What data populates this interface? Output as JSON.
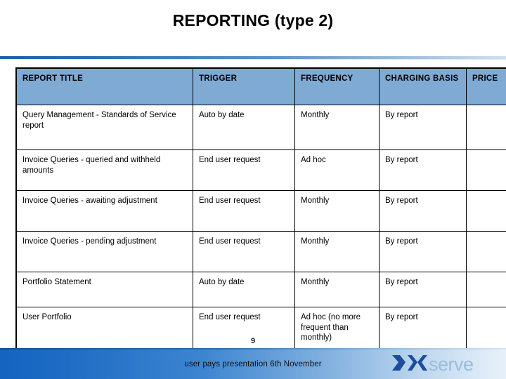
{
  "slide": {
    "title": "REPORTING (type 2)",
    "page_number": "9",
    "footer_text": "user pays presentation 6th November",
    "accent_color": "#1f5fa8",
    "header_fill": "#7FAAD4",
    "footer_gradient_start": "#1464c0",
    "footer_gradient_end": "#e8f1fa"
  },
  "logo": {
    "name": "xoserve-logo",
    "text_x": "x",
    "text_serve": "serve",
    "mark": "chevron-pair-icon",
    "dark_color": "#1B4F9C",
    "light_color": "#8FB4D8"
  },
  "table": {
    "name": "reporting-table",
    "columns": [
      "REPORT TITLE",
      "TRIGGER",
      "FREQUENCY",
      "CHARGING BASIS",
      "PRICE"
    ],
    "rows": [
      {
        "title": "Query Management - Standards of Service report",
        "trigger": "Auto by date",
        "frequency": "Monthly",
        "charging_basis": "By report",
        "price": ""
      },
      {
        "title": "Invoice Queries - queried and withheld amounts",
        "trigger": "End user request",
        "frequency": "Ad hoc",
        "charging_basis": "By report",
        "price": ""
      },
      {
        "title": "Invoice Queries - awaiting adjustment",
        "trigger": "End user request",
        "frequency": "Monthly",
        "charging_basis": "By report",
        "price": ""
      },
      {
        "title": "Invoice Queries - pending adjustment",
        "trigger": "End user request",
        "frequency": "Monthly",
        "charging_basis": "By report",
        "price": ""
      },
      {
        "title": "Portfolio Statement",
        "trigger": "Auto by date",
        "frequency": "Monthly",
        "charging_basis": "By report",
        "price": ""
      },
      {
        "title": "User Portfolio",
        "trigger": "End user request",
        "frequency": "Ad hoc (no more frequent than monthly)",
        "charging_basis": "By report",
        "price": ""
      }
    ]
  }
}
